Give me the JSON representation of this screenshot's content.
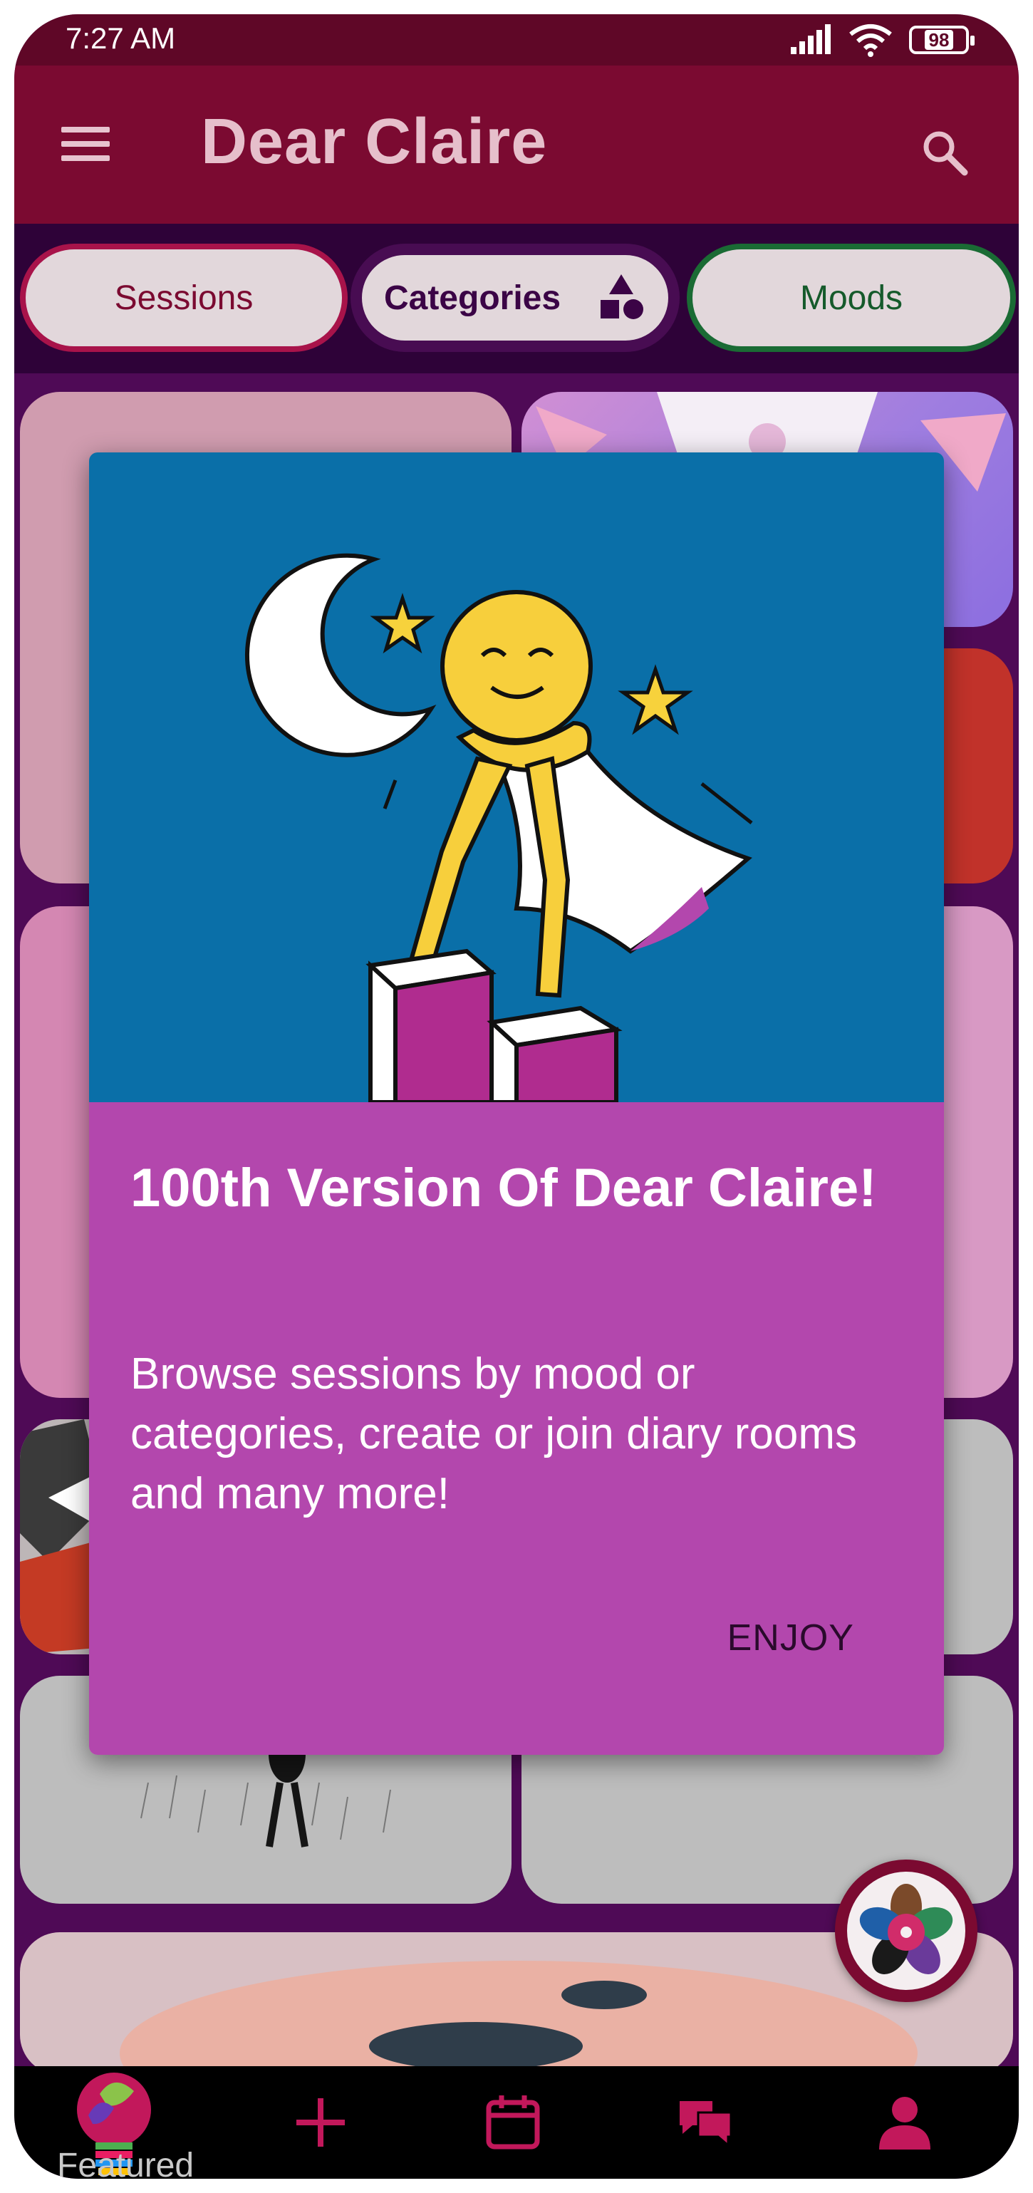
{
  "status_bar": {
    "time": "7:27 AM",
    "battery": "98",
    "icons": [
      "signal-icon",
      "wifi-icon",
      "battery-icon"
    ]
  },
  "app_bar": {
    "title": "Dear Claire",
    "icons": [
      "menu-icon",
      "search-icon"
    ]
  },
  "filters": {
    "sessions": "Sessions",
    "categories": "Categories",
    "moods": "Moods"
  },
  "dialog": {
    "title": "100th Version Of Dear Claire!",
    "message": "Browse sessions by mood or categories, create or join diary rooms and many more!",
    "action": "ENJOY"
  },
  "bottom_nav": {
    "featured_label": "Featured",
    "icons": [
      "lightbulb-icon",
      "plus-icon",
      "calendar-icon",
      "chat-icon",
      "profile-icon"
    ]
  },
  "colors": {
    "app_bar": "#7b0a31",
    "dialog_image_bg": "#0a6fa8",
    "dialog_body_bg": "#b347ad",
    "accent": "#c2185b"
  }
}
